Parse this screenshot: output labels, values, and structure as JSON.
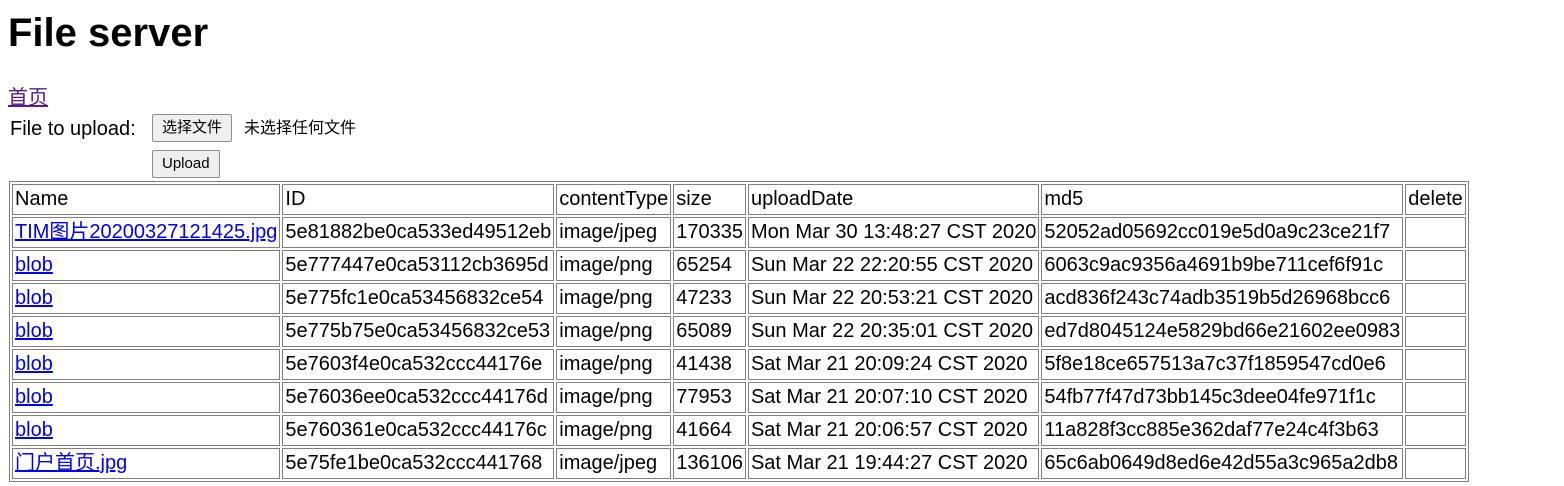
{
  "page": {
    "title": "File server",
    "home_link": "首页"
  },
  "upload": {
    "label": "File to upload:",
    "choose_button": "选择文件",
    "no_file_text": "未选择任何文件",
    "submit_button": "Upload"
  },
  "table": {
    "headers": [
      "Name",
      "ID",
      "contentType",
      "size",
      "uploadDate",
      "md5",
      "delete"
    ],
    "rows": [
      {
        "name": "TIM图片20200327121425.jpg",
        "id": "5e81882be0ca533ed49512eb",
        "contentType": "image/jpeg",
        "size": "170335",
        "uploadDate": "Mon Mar 30 13:48:27 CST 2020",
        "md5": "52052ad05692cc019e5d0a9c23ce21f7",
        "delete": ""
      },
      {
        "name": "blob",
        "id": "5e777447e0ca53112cb3695d",
        "contentType": "image/png",
        "size": "65254",
        "uploadDate": "Sun Mar 22 22:20:55 CST 2020",
        "md5": "6063c9ac9356a4691b9be711cef6f91c",
        "delete": ""
      },
      {
        "name": "blob",
        "id": "5e775fc1e0ca53456832ce54",
        "contentType": "image/png",
        "size": "47233",
        "uploadDate": "Sun Mar 22 20:53:21 CST 2020",
        "md5": "acd836f243c74adb3519b5d26968bcc6",
        "delete": ""
      },
      {
        "name": "blob",
        "id": "5e775b75e0ca53456832ce53",
        "contentType": "image/png",
        "size": "65089",
        "uploadDate": "Sun Mar 22 20:35:01 CST 2020",
        "md5": "ed7d8045124e5829bd66e21602ee0983",
        "delete": ""
      },
      {
        "name": "blob",
        "id": "5e7603f4e0ca532ccc44176e",
        "contentType": "image/png",
        "size": "41438",
        "uploadDate": "Sat Mar 21 20:09:24 CST 2020",
        "md5": "5f8e18ce657513a7c37f1859547cd0e6",
        "delete": ""
      },
      {
        "name": "blob",
        "id": "5e76036ee0ca532ccc44176d",
        "contentType": "image/png",
        "size": "77953",
        "uploadDate": "Sat Mar 21 20:07:10 CST 2020",
        "md5": "54fb77f47d73bb145c3dee04fe971f1c",
        "delete": ""
      },
      {
        "name": "blob",
        "id": "5e760361e0ca532ccc44176c",
        "contentType": "image/png",
        "size": "41664",
        "uploadDate": "Sat Mar 21 20:06:57 CST 2020",
        "md5": "11a828f3cc885e362daf77e24c4f3b63",
        "delete": ""
      },
      {
        "name": "门户首页.jpg",
        "id": "5e75fe1be0ca532ccc441768",
        "contentType": "image/jpeg",
        "size": "136106",
        "uploadDate": "Sat Mar 21 19:44:27 CST 2020",
        "md5": "65c6ab0649d8ed6e42d55a3c965a2db8",
        "delete": ""
      }
    ]
  },
  "colors": {
    "link": "#0000ee",
    "visited_link": "#551a8b",
    "table_border": "#808080",
    "button_bg": "#efefef"
  }
}
